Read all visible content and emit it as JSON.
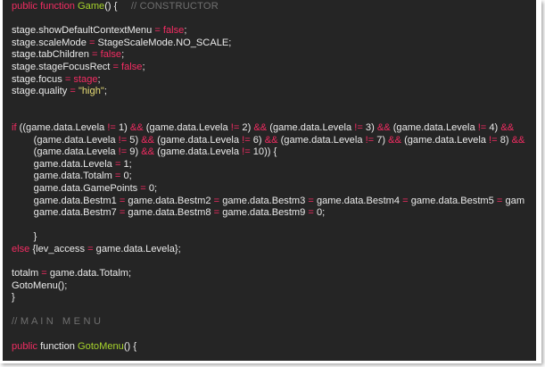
{
  "editor": {
    "background": "#252525",
    "colors": {
      "plain": "#eaeaea",
      "keyword": "#f22c62",
      "function": "#a6d22c",
      "operator": "#f22c62",
      "comment": "#6f6f6f",
      "string": "#e6db74"
    },
    "lines": [
      [
        [
          "keyword",
          "public function "
        ],
        [
          "func",
          "Game"
        ],
        [
          "plain",
          "() {     "
        ],
        [
          "comment",
          "// CONSTRUCTOR"
        ]
      ],
      [],
      [
        [
          "plain",
          "stage.showDefaultContextMenu "
        ],
        [
          "op",
          "="
        ],
        [
          "plain",
          " "
        ],
        [
          "keyword",
          "false"
        ],
        [
          "plain",
          ";"
        ]
      ],
      [
        [
          "plain",
          "stage.scaleMode "
        ],
        [
          "op",
          "="
        ],
        [
          "plain",
          " StageScaleMode.NO_SCALE;"
        ]
      ],
      [
        [
          "plain",
          "stage.tabChildren "
        ],
        [
          "op",
          "="
        ],
        [
          "plain",
          " "
        ],
        [
          "keyword",
          "false"
        ],
        [
          "plain",
          ";"
        ]
      ],
      [
        [
          "plain",
          "stage.stageFocusRect "
        ],
        [
          "op",
          "="
        ],
        [
          "plain",
          " "
        ],
        [
          "keyword",
          "false"
        ],
        [
          "plain",
          ";"
        ]
      ],
      [
        [
          "plain",
          "stage.focus "
        ],
        [
          "op",
          "="
        ],
        [
          "plain",
          " "
        ],
        [
          "keyword",
          "stage"
        ],
        [
          "plain",
          ";"
        ]
      ],
      [
        [
          "plain",
          "stage.quality "
        ],
        [
          "op",
          "="
        ],
        [
          "plain",
          " "
        ],
        [
          "str",
          "\"high\""
        ],
        [
          "plain",
          ";"
        ]
      ],
      [],
      [],
      [
        [
          "keyword",
          "if"
        ],
        [
          "plain",
          " ((game.data.Levela "
        ],
        [
          "op",
          "!="
        ],
        [
          "plain",
          " 1) "
        ],
        [
          "op",
          "&&"
        ],
        [
          "plain",
          " (game.data.Levela "
        ],
        [
          "op",
          "!="
        ],
        [
          "plain",
          " 2) "
        ],
        [
          "op",
          "&&"
        ],
        [
          "plain",
          " (game.data.Levela "
        ],
        [
          "op",
          "!="
        ],
        [
          "plain",
          " 3) "
        ],
        [
          "op",
          "&&"
        ],
        [
          "plain",
          " (game.data.Levela "
        ],
        [
          "op",
          "!="
        ],
        [
          "plain",
          " 4) "
        ],
        [
          "op",
          "&&"
        ]
      ],
      [
        [
          "plain",
          "        (game.data.Levela "
        ],
        [
          "op",
          "!="
        ],
        [
          "plain",
          " 5) "
        ],
        [
          "op",
          "&&"
        ],
        [
          "plain",
          " (game.data.Levela "
        ],
        [
          "op",
          "!="
        ],
        [
          "plain",
          " 6) "
        ],
        [
          "op",
          "&&"
        ],
        [
          "plain",
          " (game.data.Levela "
        ],
        [
          "op",
          "!="
        ],
        [
          "plain",
          " 7) "
        ],
        [
          "op",
          "&&"
        ],
        [
          "plain",
          " (game.data.Levela "
        ],
        [
          "op",
          "!="
        ],
        [
          "plain",
          " 8) "
        ],
        [
          "op",
          "&&"
        ]
      ],
      [
        [
          "plain",
          "        (game.data.Levela "
        ],
        [
          "op",
          "!="
        ],
        [
          "plain",
          " 9) "
        ],
        [
          "op",
          "&&"
        ],
        [
          "plain",
          " (game.data.Levela "
        ],
        [
          "op",
          "!="
        ],
        [
          "plain",
          " 10)) {"
        ]
      ],
      [
        [
          "plain",
          "        game.data.Levela "
        ],
        [
          "op",
          "="
        ],
        [
          "plain",
          " 1;"
        ]
      ],
      [
        [
          "plain",
          "        game.data.Totalm "
        ],
        [
          "op",
          "="
        ],
        [
          "plain",
          " 0;"
        ]
      ],
      [
        [
          "plain",
          "        game.data.GamePoints "
        ],
        [
          "op",
          "="
        ],
        [
          "plain",
          " 0;"
        ]
      ],
      [
        [
          "plain",
          "        game.data.Bestm1 "
        ],
        [
          "op",
          "="
        ],
        [
          "plain",
          " game.data.Bestm2 "
        ],
        [
          "op",
          "="
        ],
        [
          "plain",
          " game.data.Bestm3 "
        ],
        [
          "op",
          "="
        ],
        [
          "plain",
          " game.data.Bestm4 "
        ],
        [
          "op",
          "="
        ],
        [
          "plain",
          " game.data.Bestm5 "
        ],
        [
          "op",
          "="
        ],
        [
          "plain",
          " gam"
        ]
      ],
      [
        [
          "plain",
          "        game.data.Bestm7 "
        ],
        [
          "op",
          "="
        ],
        [
          "plain",
          " game.data.Bestm8 "
        ],
        [
          "op",
          "="
        ],
        [
          "plain",
          " game.data.Bestm9 "
        ],
        [
          "op",
          "="
        ],
        [
          "plain",
          " 0;"
        ]
      ],
      [],
      [
        [
          "plain",
          "        }"
        ]
      ],
      [
        [
          "keyword",
          "else"
        ],
        [
          "plain",
          " {lev_access "
        ],
        [
          "op",
          "="
        ],
        [
          "plain",
          " game.data.Levela};"
        ]
      ],
      [],
      [
        [
          "plain",
          "totalm "
        ],
        [
          "op",
          "="
        ],
        [
          "plain",
          " game.data.Totalm;"
        ]
      ],
      [
        [
          "plain",
          "GotoMenu();"
        ]
      ],
      [
        [
          "plain",
          "}"
        ]
      ],
      [],
      [
        [
          "comment",
          "// M A I N   M E N U"
        ]
      ],
      [],
      [
        [
          "keyword",
          "public"
        ],
        [
          "plain",
          " function "
        ],
        [
          "func",
          "GotoMenu"
        ],
        [
          "plain",
          "() {"
        ]
      ]
    ]
  }
}
